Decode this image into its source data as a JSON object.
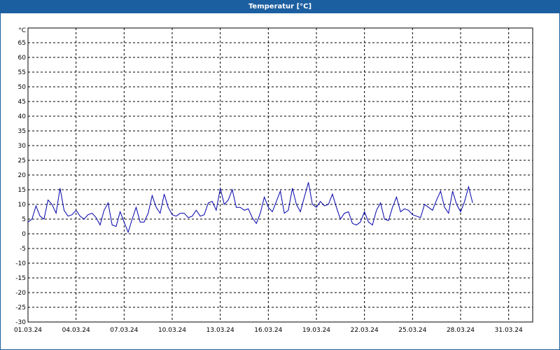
{
  "window": {
    "title": "Temperatur [°C]"
  },
  "chart_data": {
    "type": "line",
    "title": "Temperatur [°C]",
    "ylabel_unit": "°C",
    "ylim": [
      -30,
      70
    ],
    "y_ticks": [
      -30,
      -25,
      -20,
      -15,
      -10,
      -5,
      0,
      5,
      10,
      15,
      20,
      25,
      30,
      35,
      40,
      45,
      50,
      55,
      60,
      65
    ],
    "x_tick_labels": [
      "01.03.24",
      "04.03.24",
      "07.03.24",
      "10.03.24",
      "13.03.24",
      "16.03.24",
      "19.03.24",
      "22.03.24",
      "25.03.24",
      "28.03.24",
      "31.03.24"
    ],
    "x_days_span": 31.5,
    "grid": true,
    "line_color": "#0000aa",
    "series": [
      {
        "day_step": 0.25,
        "values": [
          4,
          5,
          9.5,
          6,
          5,
          11.5,
          10,
          7,
          15.5,
          8,
          6,
          6.5,
          8,
          6,
          5,
          6.5,
          7,
          5.5,
          3,
          8,
          10.5,
          3,
          2.5,
          7.5,
          4,
          0.5,
          5,
          9,
          4,
          4,
          7,
          13,
          9,
          7,
          13.5,
          9,
          6.5,
          6,
          7,
          7,
          5.5,
          6,
          8,
          6,
          6.5,
          10.5,
          11,
          8,
          15.5,
          10,
          11.5,
          15,
          9,
          9,
          8,
          8.5,
          5.5,
          3.5,
          7,
          12.5,
          9,
          7.5,
          11,
          14.5,
          7,
          8,
          15.5,
          10,
          7.5,
          12.5,
          17.5,
          10,
          9,
          11,
          9.5,
          10,
          13.5,
          9,
          5,
          7,
          7.5,
          3.5,
          3,
          4,
          7.5,
          4,
          3,
          8,
          10.5,
          5,
          4.5,
          9,
          12.5,
          7.5,
          8.5,
          8,
          6.5,
          6,
          5.5,
          10,
          9,
          8,
          11.5,
          14.5,
          9,
          7,
          14.5,
          10,
          7.5,
          11,
          16,
          10.5
        ]
      }
    ]
  }
}
